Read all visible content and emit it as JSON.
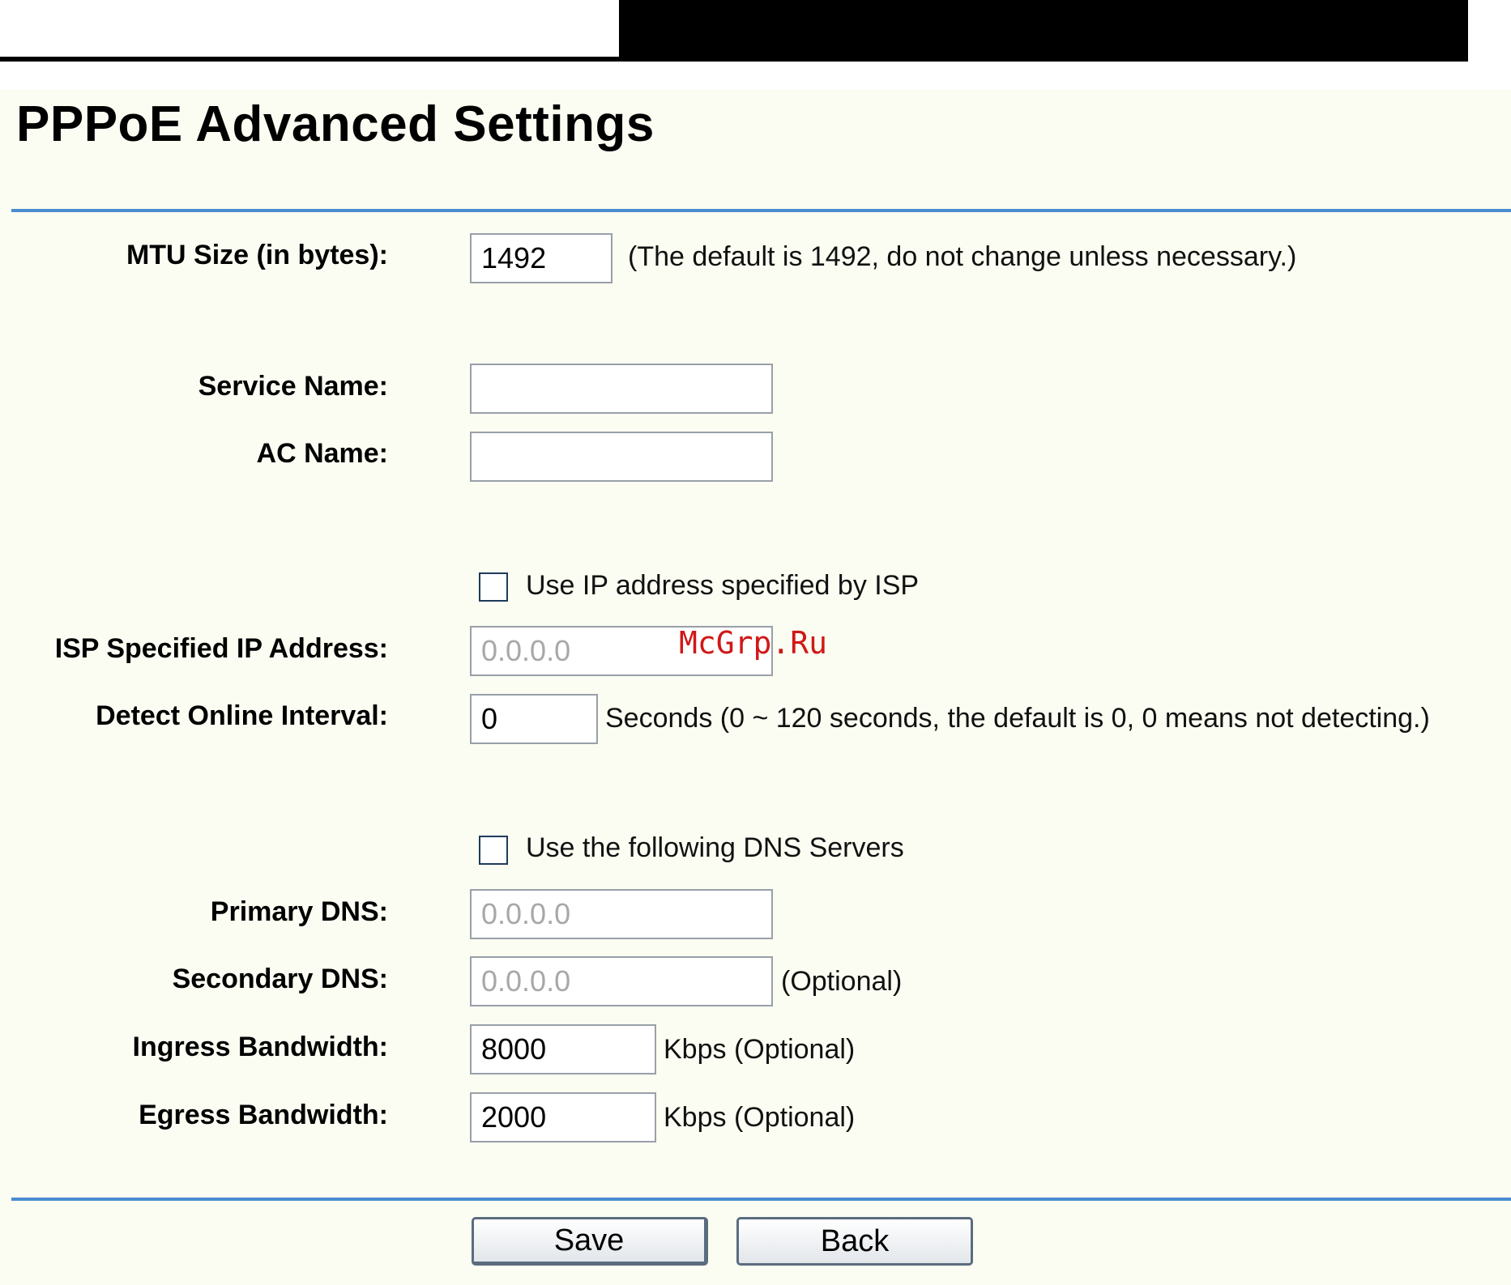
{
  "page": {
    "title": "PPPoE Advanced Settings",
    "watermark": "McGrp.Ru",
    "colors": {
      "divider": "#4a8ccf",
      "panel_bg": "#fbfdf2",
      "watermark": "#d01818"
    }
  },
  "mtu": {
    "label": "MTU Size (in bytes):",
    "value": "1492",
    "note": "(The default is 1492, do not change unless necessary.)"
  },
  "service_name": {
    "label": "Service Name:",
    "value": ""
  },
  "ac_name": {
    "label": "AC Name:",
    "value": ""
  },
  "use_isp_ip": {
    "label": "Use IP address specified by ISP",
    "checked": false
  },
  "isp_ip": {
    "label": "ISP Specified IP Address:",
    "value": "0.0.0.0",
    "disabled": true
  },
  "detect_interval": {
    "label": "Detect Online Interval:",
    "value": "0",
    "note": "Seconds (0 ~ 120 seconds, the default is 0, 0 means not detecting.)"
  },
  "use_dns": {
    "label": "Use the following DNS Servers",
    "checked": false
  },
  "primary_dns": {
    "label": "Primary DNS:",
    "value": "0.0.0.0",
    "disabled": true
  },
  "secondary_dns": {
    "label": "Secondary DNS:",
    "value": "0.0.0.0",
    "disabled": true,
    "note": "(Optional)"
  },
  "ingress": {
    "label": "Ingress Bandwidth:",
    "value": "8000",
    "note": "Kbps (Optional)"
  },
  "egress": {
    "label": "Egress Bandwidth:",
    "value": "2000",
    "note": "Kbps (Optional)"
  },
  "buttons": {
    "save": "Save",
    "back": "Back"
  }
}
